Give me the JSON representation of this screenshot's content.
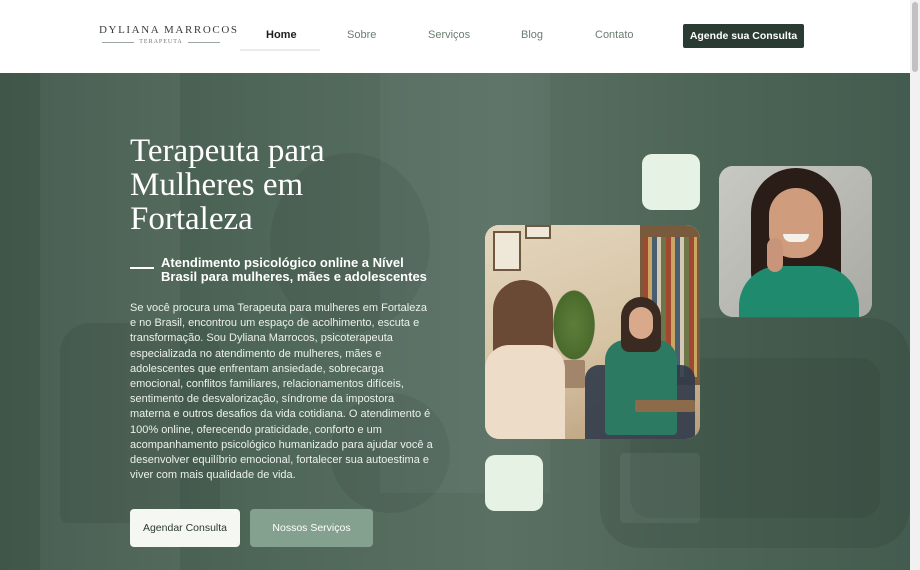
{
  "logo": {
    "name": "DYLIANA MARROCOS",
    "role": "TERAPEUTA"
  },
  "nav": {
    "items": [
      {
        "label": "Home",
        "active": true
      },
      {
        "label": "Sobre",
        "active": false
      },
      {
        "label": "Serviços",
        "active": false
      },
      {
        "label": "Blog",
        "active": false
      },
      {
        "label": "Contato",
        "active": false
      }
    ],
    "cta_label": "Agende sua Consulta"
  },
  "hero": {
    "title": "Terapeuta para Mulheres em Fortaleza",
    "subtitle": "Atendimento psicológico online a Nível Brasil para mulheres, mães e adolescentes",
    "body": "Se você procura uma Terapeuta para mulheres em Fortaleza e no Brasil, encontrou um espaço de acolhimento, escuta e transformação. Sou Dyliana Marrocos, psicoterapeuta especializada no atendimento de mulheres, mães e adolescentes que enfrentam ansiedade, sobrecarga emocional, conflitos familiares, relacionamentos difíceis, sentimento de desvalorização, síndrome da impostora materna e outros desafios da vida cotidiana. O atendimento é 100% online, oferecendo praticidade, conforto e um acompanhamento psicológico humanizado para ajudar você a desenvolver equilíbrio emocional, fortalecer sua autoestima e viver com mais qualidade de vida.",
    "primary_button": "Agendar Consulta",
    "secondary_button": "Nossos Serviços"
  },
  "colors": {
    "hero_bg": "#4f6759",
    "cta_dark": "#2a3b33",
    "accent_mint": "#e6f2e4",
    "secondary_btn": "#84a08f"
  }
}
